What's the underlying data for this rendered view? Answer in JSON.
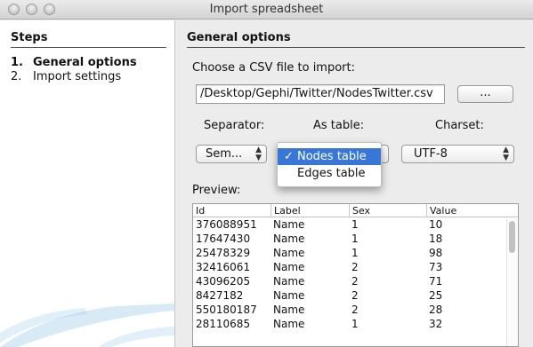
{
  "window": {
    "title": "Import spreadsheet"
  },
  "steps": {
    "heading": "Steps",
    "items": [
      {
        "number": "1.",
        "label": "General options",
        "active": true
      },
      {
        "number": "2.",
        "label": "Import settings",
        "active": false
      }
    ]
  },
  "general": {
    "heading": "General options",
    "choose_label": "Choose a CSV file to import:",
    "file_path": "/Desktop/Gephi/Twitter/NodesTwitter.csv",
    "browse_label": "...",
    "separator": {
      "label": "Separator:",
      "value": "Sem..."
    },
    "as_table": {
      "label": "As table:",
      "options": [
        {
          "label": "Nodes table",
          "selected": true
        },
        {
          "label": "Edges table",
          "selected": false
        }
      ]
    },
    "charset": {
      "label": "Charset:",
      "value": "UTF-8"
    },
    "preview_label": "Preview:"
  },
  "preview": {
    "columns": [
      "Id",
      "Label",
      "Sex",
      "Value"
    ],
    "rows": [
      [
        "376088951",
        "Name",
        "1",
        "10"
      ],
      [
        "17647430",
        "Name",
        "1",
        "18"
      ],
      [
        "25478329",
        "Name",
        "1",
        "98"
      ],
      [
        "32416061",
        "Name",
        "2",
        "73"
      ],
      [
        "43096205",
        "Name",
        "2",
        "71"
      ],
      [
        "8427182",
        "Name",
        "2",
        "25"
      ],
      [
        "550180187",
        "Name",
        "2",
        "28"
      ],
      [
        "28110685",
        "Name",
        "1",
        "32"
      ]
    ]
  },
  "colors": {
    "selection": "#3876d8",
    "decor": "#a8d0ea"
  }
}
